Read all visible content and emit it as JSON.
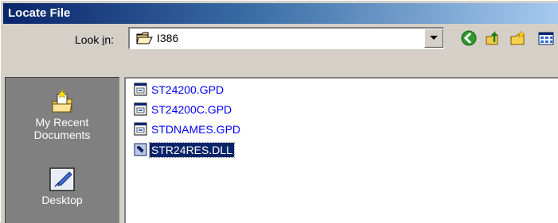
{
  "window": {
    "title": "Locate File"
  },
  "lookin": {
    "label_before": "Look ",
    "label_accel": "i",
    "label_after": "n:",
    "value": "I386",
    "icon": "folder-open-icon"
  },
  "toolbar": {
    "buttons": [
      {
        "icon": "back-arrow-icon"
      },
      {
        "icon": "up-folder-icon"
      },
      {
        "icon": "new-folder-icon"
      },
      {
        "icon": "view-menu-icon"
      }
    ]
  },
  "places": [
    {
      "label_line1": "My Recent",
      "label_line2": "Documents",
      "icon": "recent-documents-icon"
    },
    {
      "label": "Desktop",
      "icon": "desktop-icon"
    }
  ],
  "files": [
    {
      "name": "ST24200.GPD",
      "icon": "gpd-file-icon",
      "selected": false
    },
    {
      "name": "ST24200C.GPD",
      "icon": "gpd-file-icon",
      "selected": false
    },
    {
      "name": "STDNAMES.GPD",
      "icon": "gpd-file-icon",
      "selected": false
    },
    {
      "name": "STR24RES.DLL",
      "icon": "dll-file-icon",
      "selected": true
    }
  ],
  "colors": {
    "title_gradient_start": "#0a246a",
    "title_gradient_end": "#a6caf0",
    "selection": "#0a246a",
    "file_text": "#0000ff",
    "places_bg": "#808080"
  }
}
